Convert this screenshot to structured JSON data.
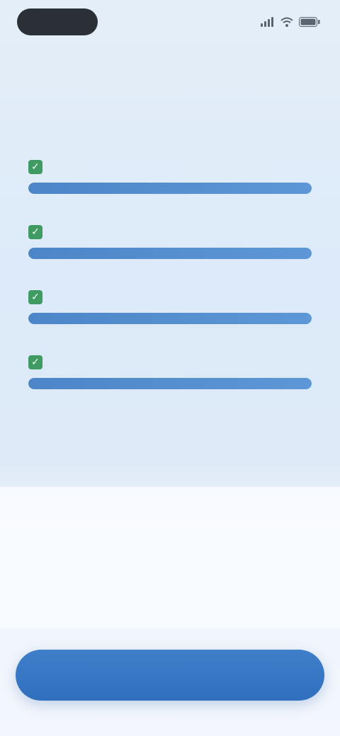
{
  "status_bar": {
    "time": "",
    "icons": [
      "signal-icon",
      "wifi-icon",
      "battery-icon"
    ]
  },
  "page": {
    "title": ""
  },
  "options": [
    {
      "label": "",
      "checked": true,
      "level": 1.0
    },
    {
      "label": "",
      "checked": true,
      "level": 1.0
    },
    {
      "label": "",
      "checked": true,
      "level": 1.0
    },
    {
      "label": "",
      "checked": true,
      "level": 1.0
    }
  ],
  "card": {
    "label": "",
    "value": "",
    "subtext": ""
  },
  "primary_button": {
    "label": ""
  },
  "colors": {
    "accent": "#2f6fbd",
    "check": "#3f9b62",
    "bar_track": "#c6d9ef",
    "background": "#e4eef8"
  }
}
